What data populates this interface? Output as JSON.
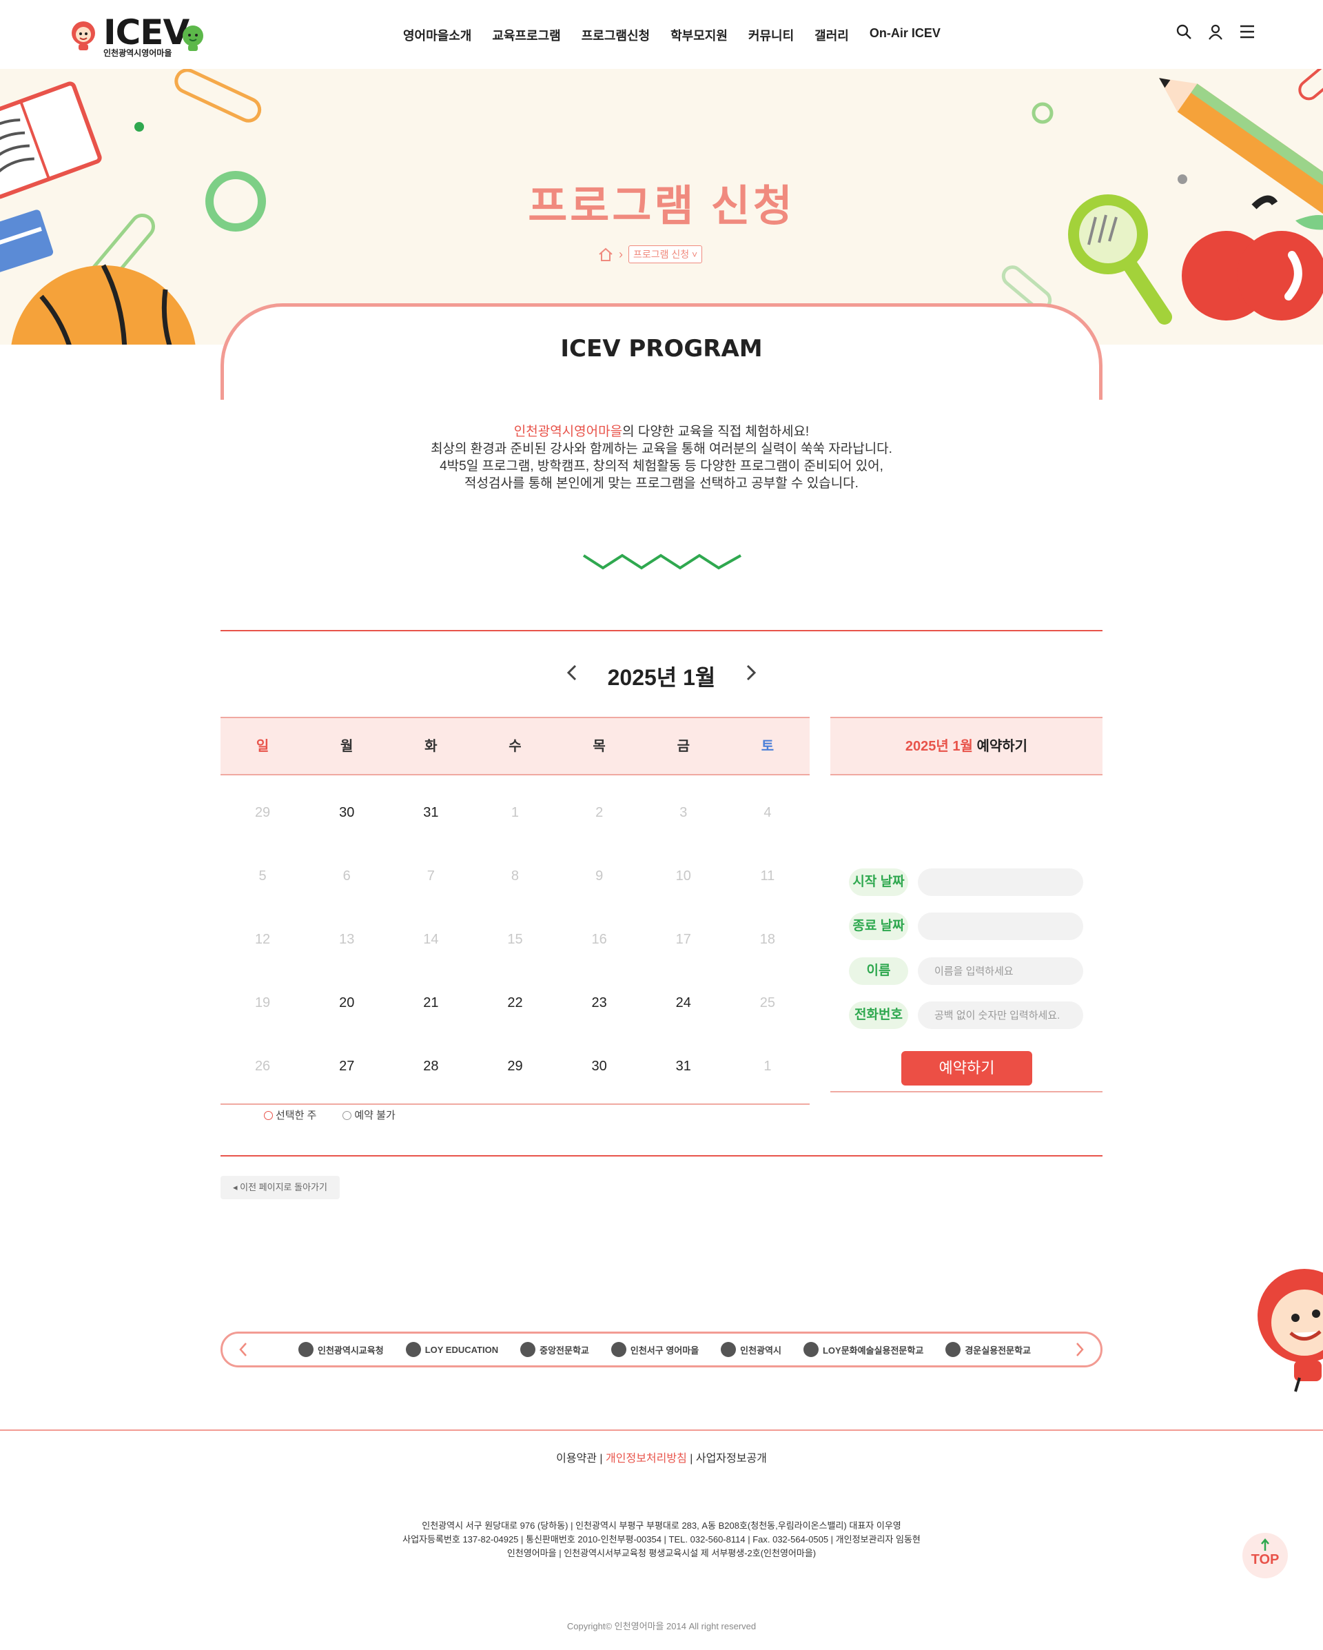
{
  "header": {
    "logo_text": "ICEV",
    "logo_sub": "인천광역시영어마을",
    "nav": [
      "영어마을소개",
      "교육프로그램",
      "프로그램신청",
      "학부모지원",
      "커뮤니티",
      "갤러리",
      "On-Air ICEV"
    ]
  },
  "hero": {
    "title": "프로그램 신청",
    "breadcrumb_select": "프로그램 신청"
  },
  "program": {
    "title": "ICEV PROGRAM",
    "intro_highlight": "인천광역시영어마을",
    "intro_line1_rest": "의 다양한 교육을 직접 체험하세요!",
    "intro_line2": "최상의 환경과 준비된 강사와 함께하는 교육을 통해 여러분의 실력이 쑥쑥 자라납니다.",
    "intro_line3": "4박5일 프로그램, 방학캠프, 창의적 체험활동 등 다양한 프로그램이 준비되어 있어,",
    "intro_line4": "적성검사를 통해 본인에게 맞는 프로그램을 선택하고 공부할 수 있습니다."
  },
  "calendar": {
    "month_label": "2025년 1월",
    "weekdays": [
      "일",
      "월",
      "화",
      "수",
      "목",
      "금",
      "토"
    ],
    "weekday_colors": [
      "#e8534a",
      "#333333",
      "#333333",
      "#333333",
      "#333333",
      "#333333",
      "#4a7fd8"
    ],
    "weeks": [
      [
        {
          "d": "29",
          "on": false
        },
        {
          "d": "30",
          "on": true
        },
        {
          "d": "31",
          "on": true
        },
        {
          "d": "1",
          "on": false
        },
        {
          "d": "2",
          "on": false
        },
        {
          "d": "3",
          "on": false
        },
        {
          "d": "4",
          "on": false
        }
      ],
      [
        {
          "d": "5",
          "on": false
        },
        {
          "d": "6",
          "on": false
        },
        {
          "d": "7",
          "on": false
        },
        {
          "d": "8",
          "on": false
        },
        {
          "d": "9",
          "on": false
        },
        {
          "d": "10",
          "on": false
        },
        {
          "d": "11",
          "on": false
        }
      ],
      [
        {
          "d": "12",
          "on": false
        },
        {
          "d": "13",
          "on": false
        },
        {
          "d": "14",
          "on": false
        },
        {
          "d": "15",
          "on": false
        },
        {
          "d": "16",
          "on": false
        },
        {
          "d": "17",
          "on": false
        },
        {
          "d": "18",
          "on": false
        }
      ],
      [
        {
          "d": "19",
          "on": false
        },
        {
          "d": "20",
          "on": true
        },
        {
          "d": "21",
          "on": true
        },
        {
          "d": "22",
          "on": true
        },
        {
          "d": "23",
          "on": true
        },
        {
          "d": "24",
          "on": true
        },
        {
          "d": "25",
          "on": false
        }
      ],
      [
        {
          "d": "26",
          "on": false
        },
        {
          "d": "27",
          "on": true
        },
        {
          "d": "28",
          "on": true
        },
        {
          "d": "29",
          "on": true
        },
        {
          "d": "30",
          "on": true
        },
        {
          "d": "31",
          "on": true
        },
        {
          "d": "1",
          "on": false
        }
      ]
    ],
    "legend_selected": "선택한 주",
    "legend_unavailable": "예약 불가",
    "legend_selected_color": "#e8534a",
    "legend_unavailable_color": "#999999"
  },
  "booking": {
    "header_highlight": "2025년 1월",
    "header_rest": " 예약하기",
    "fields": {
      "start_label": "시작 날짜",
      "end_label": "종료 날짜",
      "name_label": "이름",
      "name_placeholder": "이름을 입력하세요",
      "phone_label": "전화번호",
      "phone_placeholder": "공백 없이 숫자만 입력하세요."
    },
    "submit_label": "예약하기"
  },
  "back_label": "이전 페이지로 돌아가기",
  "partners": [
    "인천광역시교육청",
    "LOY EDUCATION",
    "중앙전문학교",
    "인천서구 영어마을",
    "인천광역시",
    "LOY문화예술실용전문학교",
    "경운실용전문학교"
  ],
  "footer": {
    "link_terms": "이용약관",
    "link_privacy": "개인정보처리방침",
    "link_biz": "사업자정보공개",
    "info1": "인천광역시 서구 원당대로 976 (당하동) | 인천광역시 부평구 부평대로 283, A동 B208호(청천동,우림라이온스밸리) 대표자 이우영",
    "info2": "사업자등록번호 137-82-04925 | 통신판매번호 2010-인천부평-00354 | TEL. 032-560-8114 | Fax. 032-564-0505 | 개인정보관리자 임동현",
    "info3": "인천영어마을 | 인천광역시서부교육청 평생교육시설 제 서부평생-2호(인천영어마을)",
    "copyright": "Copyright© 인천영어마을 2014 All right reserved",
    "top_label": "TOP"
  },
  "colors": {
    "accent": "#e8534a",
    "pink": "#f29b93",
    "green": "#2fa84f",
    "hero_bg": "#fcf7ec"
  }
}
